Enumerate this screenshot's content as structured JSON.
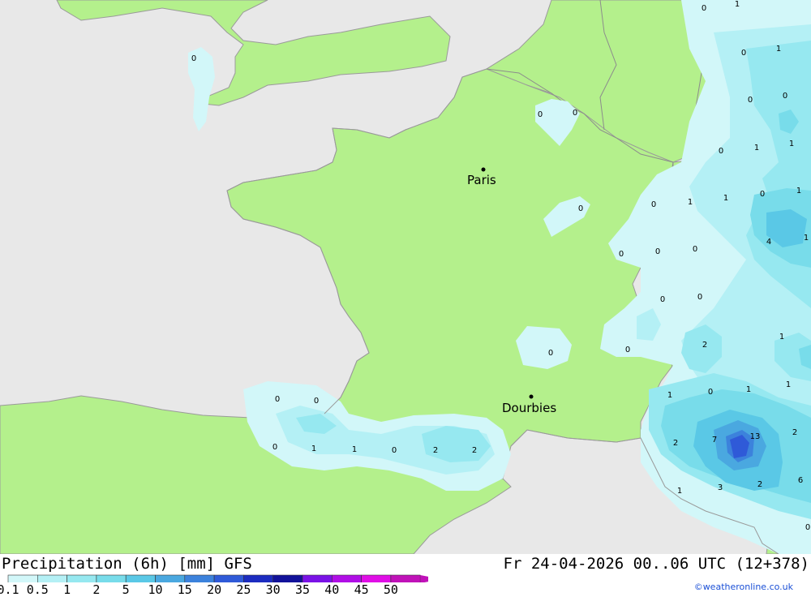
{
  "map": {
    "cities": [
      {
        "name": "Paris"
      },
      {
        "name": "Dourbies"
      }
    ],
    "values": [
      "0",
      "1",
      "0",
      "0",
      "1",
      "0",
      "0",
      "1",
      "1",
      "0",
      "0",
      "0",
      "1",
      "0",
      "1",
      "1",
      "0",
      "4",
      "1",
      "0",
      "0",
      "0",
      "0",
      "0",
      "0",
      "2",
      "1",
      "0",
      "0",
      "1",
      "0",
      "1",
      "1",
      "2",
      "7",
      "13",
      "2",
      "6",
      "1",
      "3",
      "2",
      "0",
      "0",
      "0",
      "0",
      "1",
      "1",
      "0",
      "2",
      "2"
    ]
  },
  "footer": {
    "title": "Precipitation (6h) [mm] GFS",
    "datetime": "Fr 24-04-2026 00..06 UTC (12+378)",
    "credit": "©weatheronline.co.uk"
  },
  "legend": {
    "labels": [
      "0.1",
      "0.5",
      "1",
      "2",
      "5",
      "10",
      "15",
      "20",
      "25",
      "30",
      "35",
      "40",
      "45",
      "50"
    ],
    "colors": [
      "#d2f7f9",
      "#b4f0f5",
      "#96e8f0",
      "#78dcea",
      "#5ac8e6",
      "#4aa8e0",
      "#3c82dc",
      "#2f5ad8",
      "#1c2cc0",
      "#12129a",
      "#7a12e6",
      "#b00ee6",
      "#e00ee6",
      "#c012b8"
    ]
  }
}
